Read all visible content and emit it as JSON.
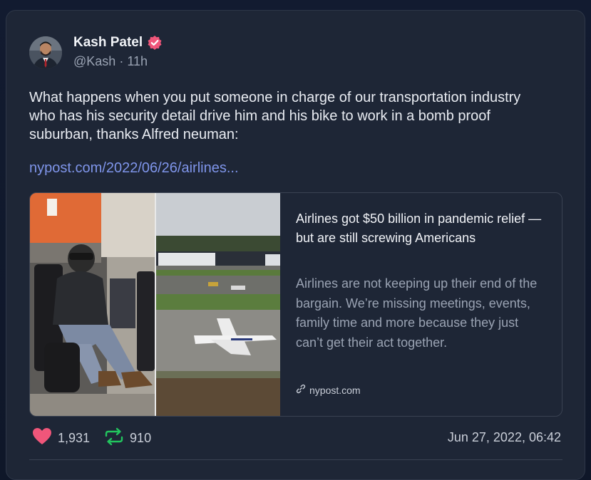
{
  "post": {
    "author": {
      "name": "Kash Patel",
      "handle": "@Kash",
      "age": "11h",
      "separator": "·",
      "verified": true
    },
    "text": "What happens when you put someone in charge of our transportation industry who has his security detail drive him and his bike to work in a bomb proof suburban, thanks Alfred neuman:",
    "link_text": "nypost.com/2022/06/26/airlines...",
    "link_card": {
      "title": "Airlines got $50 billion in pandemic relief — but are still screwing Americans",
      "description": "Airlines are not keeping up their end of the bargain. We’re missing meetings, events, family time and more because they just can’t get their act together.",
      "domain": "nypost.com"
    },
    "stats": {
      "likes": "1,931",
      "reposts": "910"
    },
    "timestamp": "Jun 27, 2022, 06:42"
  },
  "icons": {
    "verified": "verified-badge-icon",
    "like": "heart-icon",
    "repost": "repost-icon",
    "link": "link-icon"
  },
  "colors": {
    "card_bg": "#1e2636",
    "link": "#7f95ea",
    "heart": "#f0567a",
    "repost": "#22c55e",
    "verified": "#f0567a"
  }
}
